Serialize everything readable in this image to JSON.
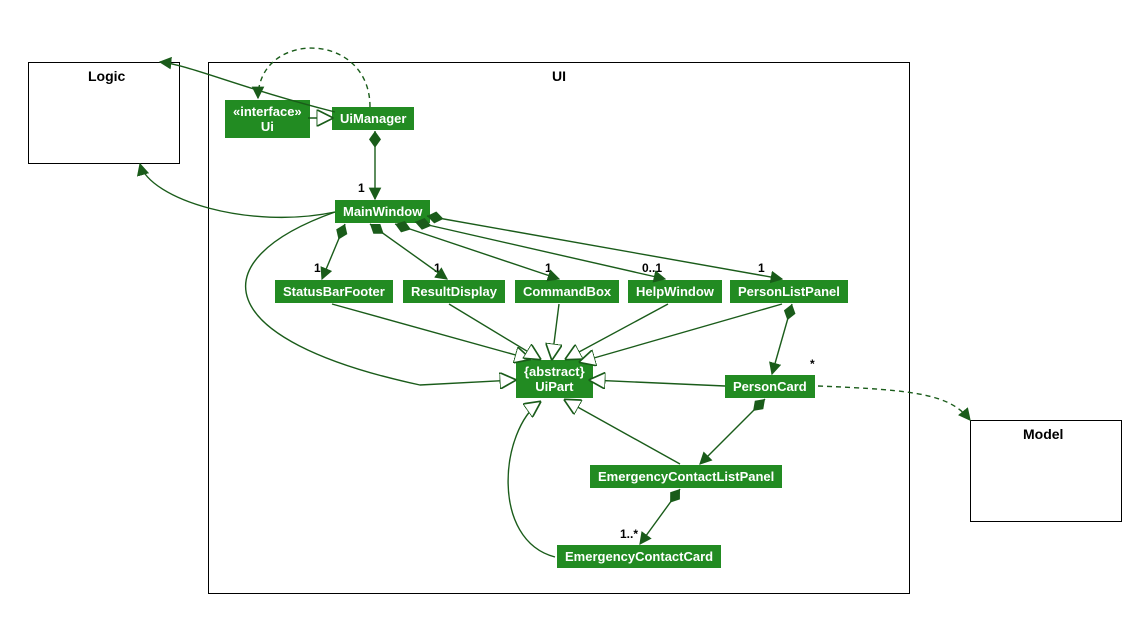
{
  "regions": {
    "logic": "Logic",
    "ui": "UI",
    "model": "Model"
  },
  "nodes": {
    "ui_interface": "«interface»\nUi",
    "ui_manager": "UiManager",
    "main_window": "MainWindow",
    "status_bar_footer": "StatusBarFooter",
    "result_display": "ResultDisplay",
    "command_box": "CommandBox",
    "help_window": "HelpWindow",
    "person_list_panel": "PersonListPanel",
    "ui_part": "{abstract}\nUiPart",
    "person_card": "PersonCard",
    "ecl_panel": "EmergencyContactListPanel",
    "ec_card": "EmergencyContactCard"
  },
  "mult": {
    "mw": "1",
    "sbf": "1",
    "rd": "1",
    "cb": "1",
    "hw": "0..1",
    "plp": "1",
    "pc": "*",
    "ecc": "1..*"
  },
  "relationships": [
    {
      "from": "UiManager",
      "to": "Ui",
      "type": "realization"
    },
    {
      "from": "UiManager",
      "to": "MainWindow",
      "type": "composition",
      "mult": "1"
    },
    {
      "from": "MainWindow",
      "to": "StatusBarFooter",
      "type": "composition",
      "mult": "1"
    },
    {
      "from": "MainWindow",
      "to": "ResultDisplay",
      "type": "composition",
      "mult": "1"
    },
    {
      "from": "MainWindow",
      "to": "CommandBox",
      "type": "composition",
      "mult": "1"
    },
    {
      "from": "MainWindow",
      "to": "HelpWindow",
      "type": "composition",
      "mult": "0..1"
    },
    {
      "from": "MainWindow",
      "to": "PersonListPanel",
      "type": "composition",
      "mult": "1"
    },
    {
      "from": "StatusBarFooter",
      "to": "UiPart",
      "type": "generalization"
    },
    {
      "from": "ResultDisplay",
      "to": "UiPart",
      "type": "generalization"
    },
    {
      "from": "CommandBox",
      "to": "UiPart",
      "type": "generalization"
    },
    {
      "from": "HelpWindow",
      "to": "UiPart",
      "type": "generalization"
    },
    {
      "from": "PersonListPanel",
      "to": "UiPart",
      "type": "generalization"
    },
    {
      "from": "MainWindow",
      "to": "UiPart",
      "type": "generalization"
    },
    {
      "from": "PersonCard",
      "to": "UiPart",
      "type": "generalization"
    },
    {
      "from": "EmergencyContactListPanel",
      "to": "UiPart",
      "type": "generalization"
    },
    {
      "from": "EmergencyContactCard",
      "to": "UiPart",
      "type": "generalization"
    },
    {
      "from": "PersonListPanel",
      "to": "PersonCard",
      "type": "composition",
      "mult": "*"
    },
    {
      "from": "PersonCard",
      "to": "EmergencyContactListPanel",
      "type": "composition"
    },
    {
      "from": "EmergencyContactListPanel",
      "to": "EmergencyContactCard",
      "type": "composition",
      "mult": "1..*"
    },
    {
      "from": "UiManager",
      "to": "Logic",
      "type": "association"
    },
    {
      "from": "MainWindow",
      "to": "Logic",
      "type": "association"
    },
    {
      "from": "PersonCard",
      "to": "Model",
      "type": "dependency"
    }
  ]
}
